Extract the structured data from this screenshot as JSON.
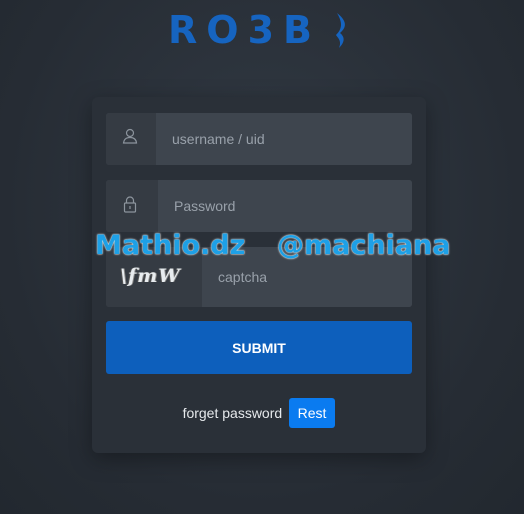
{
  "logo": {
    "text": "RO3B"
  },
  "login": {
    "username_placeholder": "username / uid",
    "password_placeholder": "Password",
    "captcha_text": "\\fmW",
    "captcha_placeholder": "captcha",
    "submit_label": "SUBMIT",
    "forget_label": "forget password",
    "rest_label": "Rest"
  },
  "watermark": {
    "left": "Mathio.dz",
    "right": "@machiana"
  },
  "colors": {
    "accent": "#0d5fbc",
    "rest_button": "#0a7bf0",
    "background": "#2a3038",
    "logo": "#1664c0",
    "watermark": "#1ea0e6"
  },
  "icons": {
    "username": "user-icon",
    "password": "lock-icon",
    "logo_mark": "flame-icon"
  }
}
